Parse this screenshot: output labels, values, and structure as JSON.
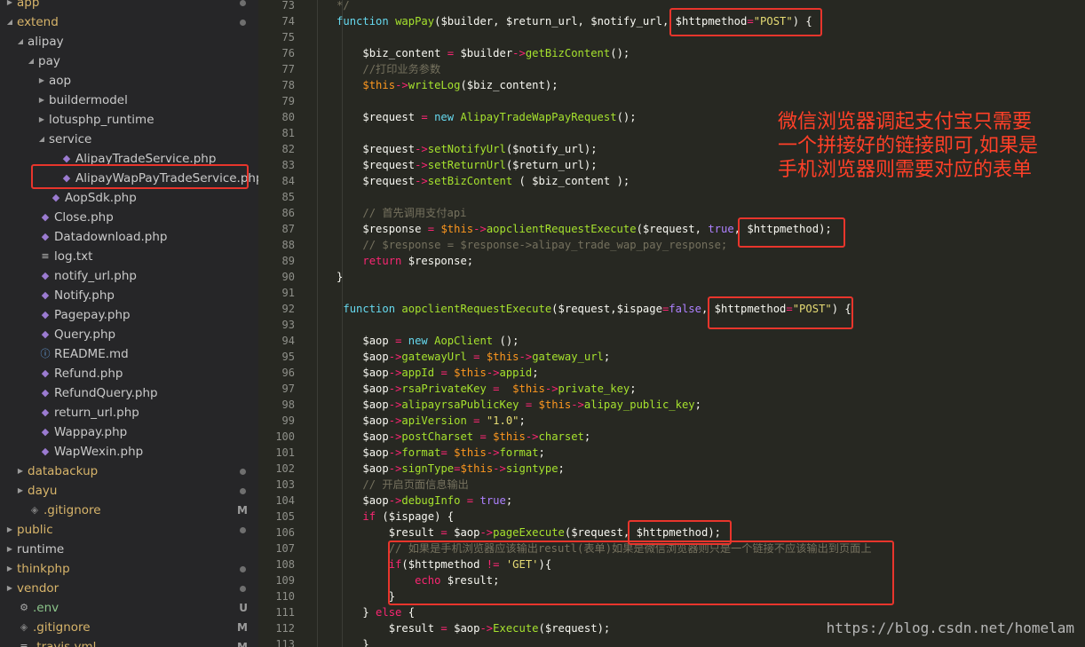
{
  "tree": [
    {
      "label": "app",
      "depth": 0,
      "type": "folder",
      "expanded": false,
      "color": "gold",
      "status": "dot"
    },
    {
      "label": "extend",
      "depth": 0,
      "type": "folder",
      "expanded": true,
      "color": "gold",
      "status": "dot"
    },
    {
      "label": "alipay",
      "depth": 1,
      "type": "folder",
      "expanded": true
    },
    {
      "label": "pay",
      "depth": 2,
      "type": "folder",
      "expanded": true
    },
    {
      "label": "aop",
      "depth": 3,
      "type": "folder",
      "expanded": false
    },
    {
      "label": "buildermodel",
      "depth": 3,
      "type": "folder",
      "expanded": false
    },
    {
      "label": "lotusphp_runtime",
      "depth": 3,
      "type": "folder",
      "expanded": false
    },
    {
      "label": "service",
      "depth": 3,
      "type": "folder",
      "expanded": true
    },
    {
      "label": "AlipayTradeService.php",
      "depth": 4,
      "type": "php"
    },
    {
      "label": "AlipayWapPayTradeService.php",
      "depth": 4,
      "type": "php",
      "highlighted": true
    },
    {
      "label": "AopSdk.php",
      "depth": 3,
      "type": "php"
    },
    {
      "label": "Close.php",
      "depth": 2,
      "type": "php"
    },
    {
      "label": "Datadownload.php",
      "depth": 2,
      "type": "php"
    },
    {
      "label": "log.txt",
      "depth": 2,
      "type": "text"
    },
    {
      "label": "notify_url.php",
      "depth": 2,
      "type": "php"
    },
    {
      "label": "Notify.php",
      "depth": 2,
      "type": "php"
    },
    {
      "label": "Pagepay.php",
      "depth": 2,
      "type": "php"
    },
    {
      "label": "Query.php",
      "depth": 2,
      "type": "php"
    },
    {
      "label": "README.md",
      "depth": 2,
      "type": "info"
    },
    {
      "label": "Refund.php",
      "depth": 2,
      "type": "php"
    },
    {
      "label": "RefundQuery.php",
      "depth": 2,
      "type": "php"
    },
    {
      "label": "return_url.php",
      "depth": 2,
      "type": "php"
    },
    {
      "label": "Wappay.php",
      "depth": 2,
      "type": "php"
    },
    {
      "label": "WapWexin.php",
      "depth": 2,
      "type": "php"
    },
    {
      "label": "databackup",
      "depth": 1,
      "type": "folder",
      "expanded": false,
      "color": "gold",
      "status": "dot"
    },
    {
      "label": "dayu",
      "depth": 1,
      "type": "folder",
      "expanded": false,
      "color": "gold",
      "status": "dot"
    },
    {
      "label": ".gitignore",
      "depth": 1,
      "type": "git",
      "color": "gold",
      "status": "M"
    },
    {
      "label": "public",
      "depth": 0,
      "type": "folder",
      "expanded": false,
      "color": "gold",
      "status": "dot"
    },
    {
      "label": "runtime",
      "depth": 0,
      "type": "folder",
      "expanded": false
    },
    {
      "label": "thinkphp",
      "depth": 0,
      "type": "folder",
      "expanded": false,
      "color": "gold",
      "status": "dot"
    },
    {
      "label": "vendor",
      "depth": 0,
      "type": "folder",
      "expanded": false,
      "color": "gold",
      "status": "dot"
    },
    {
      "label": ".env",
      "depth": 0,
      "type": "gear",
      "color": "green",
      "status": "U"
    },
    {
      "label": ".gitignore",
      "depth": 0,
      "type": "git",
      "color": "gold",
      "status": "M"
    },
    {
      "label": ".travis.yml",
      "depth": 0,
      "type": "text",
      "color": "gold",
      "status": "M"
    }
  ],
  "code_lines": [
    {
      "n": "73",
      "segs": [
        [
          "c",
          "   */"
        ]
      ]
    },
    {
      "n": "74",
      "segs": [
        [
          "p",
          "   "
        ],
        [
          "k",
          "function "
        ],
        [
          "f",
          "wapPay"
        ],
        [
          "p",
          "("
        ],
        [
          "v",
          "$builder"
        ],
        [
          "p",
          ", "
        ],
        [
          "v",
          "$return_url"
        ],
        [
          "p",
          ", "
        ],
        [
          "v",
          "$notify_url"
        ],
        [
          "p",
          ", "
        ],
        [
          "v",
          "$httpmethod"
        ],
        [
          "o",
          "="
        ],
        [
          "s",
          "\"POST\""
        ],
        [
          "p",
          ") {"
        ]
      ]
    },
    {
      "n": "75",
      "segs": []
    },
    {
      "n": "76",
      "segs": [
        [
          "p",
          "       "
        ],
        [
          "v",
          "$biz_content"
        ],
        [
          "o",
          " = "
        ],
        [
          "v",
          "$builder"
        ],
        [
          "o",
          "->"
        ],
        [
          "f",
          "getBizContent"
        ],
        [
          "p",
          "();"
        ]
      ]
    },
    {
      "n": "77",
      "segs": [
        [
          "c",
          "       //打印业务参数"
        ]
      ]
    },
    {
      "n": "78",
      "segs": [
        [
          "p",
          "       "
        ],
        [
          "vk",
          "$this"
        ],
        [
          "o",
          "->"
        ],
        [
          "f",
          "writeLog"
        ],
        [
          "p",
          "("
        ],
        [
          "v",
          "$biz_content"
        ],
        [
          "p",
          ");"
        ]
      ]
    },
    {
      "n": "79",
      "segs": []
    },
    {
      "n": "80",
      "segs": [
        [
          "p",
          "       "
        ],
        [
          "v",
          "$request"
        ],
        [
          "o",
          " = "
        ],
        [
          "k",
          "new "
        ],
        [
          "f",
          "AlipayTradeWapPayRequest"
        ],
        [
          "p",
          "();"
        ]
      ]
    },
    {
      "n": "81",
      "segs": []
    },
    {
      "n": "82",
      "segs": [
        [
          "p",
          "       "
        ],
        [
          "v",
          "$request"
        ],
        [
          "o",
          "->"
        ],
        [
          "f",
          "setNotifyUrl"
        ],
        [
          "p",
          "("
        ],
        [
          "v",
          "$notify_url"
        ],
        [
          "p",
          ");"
        ]
      ]
    },
    {
      "n": "83",
      "segs": [
        [
          "p",
          "       "
        ],
        [
          "v",
          "$request"
        ],
        [
          "o",
          "->"
        ],
        [
          "f",
          "setReturnUrl"
        ],
        [
          "p",
          "("
        ],
        [
          "v",
          "$return_url"
        ],
        [
          "p",
          ");"
        ]
      ]
    },
    {
      "n": "84",
      "segs": [
        [
          "p",
          "       "
        ],
        [
          "v",
          "$request"
        ],
        [
          "o",
          "->"
        ],
        [
          "f",
          "setBizContent"
        ],
        [
          "p",
          " ( "
        ],
        [
          "v",
          "$biz_content"
        ],
        [
          "p",
          " );"
        ]
      ]
    },
    {
      "n": "85",
      "segs": []
    },
    {
      "n": "86",
      "segs": [
        [
          "c",
          "       // 首先调用支付api"
        ]
      ]
    },
    {
      "n": "87",
      "segs": [
        [
          "p",
          "       "
        ],
        [
          "v",
          "$response"
        ],
        [
          "o",
          " = "
        ],
        [
          "vk",
          "$this"
        ],
        [
          "o",
          "->"
        ],
        [
          "f",
          "aopclientRequestExecute"
        ],
        [
          "p",
          "("
        ],
        [
          "v",
          "$request"
        ],
        [
          "p",
          ", "
        ],
        [
          "t",
          "true"
        ],
        [
          "p",
          ", "
        ],
        [
          "v",
          "$httpmethod"
        ],
        [
          "p",
          ");"
        ]
      ]
    },
    {
      "n": "88",
      "segs": [
        [
          "c",
          "       // $response = $response->alipay_trade_wap_pay_response;"
        ]
      ]
    },
    {
      "n": "89",
      "segs": [
        [
          "p",
          "       "
        ],
        [
          "kw",
          "return "
        ],
        [
          "v",
          "$response"
        ],
        [
          "p",
          ";"
        ]
      ]
    },
    {
      "n": "90",
      "segs": [
        [
          "p",
          "   }"
        ]
      ]
    },
    {
      "n": "91",
      "segs": []
    },
    {
      "n": "92",
      "segs": [
        [
          "p",
          "    "
        ],
        [
          "k",
          "function "
        ],
        [
          "f",
          "aopclientRequestExecute"
        ],
        [
          "p",
          "("
        ],
        [
          "v",
          "$request"
        ],
        [
          "p",
          ","
        ],
        [
          "v",
          "$ispage"
        ],
        [
          "o",
          "="
        ],
        [
          "t",
          "false"
        ],
        [
          "p",
          ", "
        ],
        [
          "v",
          "$httpmethod"
        ],
        [
          "o",
          "="
        ],
        [
          "s",
          "\"POST\""
        ],
        [
          "p",
          ") {"
        ]
      ]
    },
    {
      "n": "93",
      "segs": []
    },
    {
      "n": "94",
      "segs": [
        [
          "p",
          "       "
        ],
        [
          "v",
          "$aop"
        ],
        [
          "o",
          " = "
        ],
        [
          "k",
          "new "
        ],
        [
          "f",
          "AopClient"
        ],
        [
          "p",
          " ();"
        ]
      ]
    },
    {
      "n": "95",
      "segs": [
        [
          "p",
          "       "
        ],
        [
          "v",
          "$aop"
        ],
        [
          "o",
          "->"
        ],
        [
          "f",
          "gatewayUrl"
        ],
        [
          "o",
          " = "
        ],
        [
          "vk",
          "$this"
        ],
        [
          "o",
          "->"
        ],
        [
          "f",
          "gateway_url"
        ],
        [
          "p",
          ";"
        ]
      ]
    },
    {
      "n": "96",
      "segs": [
        [
          "p",
          "       "
        ],
        [
          "v",
          "$aop"
        ],
        [
          "o",
          "->"
        ],
        [
          "f",
          "appId"
        ],
        [
          "o",
          " = "
        ],
        [
          "vk",
          "$this"
        ],
        [
          "o",
          "->"
        ],
        [
          "f",
          "appid"
        ],
        [
          "p",
          ";"
        ]
      ]
    },
    {
      "n": "97",
      "segs": [
        [
          "p",
          "       "
        ],
        [
          "v",
          "$aop"
        ],
        [
          "o",
          "->"
        ],
        [
          "f",
          "rsaPrivateKey"
        ],
        [
          "o",
          " =  "
        ],
        [
          "vk",
          "$this"
        ],
        [
          "o",
          "->"
        ],
        [
          "f",
          "private_key"
        ],
        [
          "p",
          ";"
        ]
      ]
    },
    {
      "n": "98",
      "segs": [
        [
          "p",
          "       "
        ],
        [
          "v",
          "$aop"
        ],
        [
          "o",
          "->"
        ],
        [
          "f",
          "alipayrsaPublicKey"
        ],
        [
          "o",
          " = "
        ],
        [
          "vk",
          "$this"
        ],
        [
          "o",
          "->"
        ],
        [
          "f",
          "alipay_public_key"
        ],
        [
          "p",
          ";"
        ]
      ]
    },
    {
      "n": "99",
      "segs": [
        [
          "p",
          "       "
        ],
        [
          "v",
          "$aop"
        ],
        [
          "o",
          "->"
        ],
        [
          "f",
          "apiVersion"
        ],
        [
          "o",
          " = "
        ],
        [
          "s",
          "\"1.0\""
        ],
        [
          "p",
          ";"
        ]
      ]
    },
    {
      "n": "100",
      "segs": [
        [
          "p",
          "       "
        ],
        [
          "v",
          "$aop"
        ],
        [
          "o",
          "->"
        ],
        [
          "f",
          "postCharset"
        ],
        [
          "o",
          " = "
        ],
        [
          "vk",
          "$this"
        ],
        [
          "o",
          "->"
        ],
        [
          "f",
          "charset"
        ],
        [
          "p",
          ";"
        ]
      ]
    },
    {
      "n": "101",
      "segs": [
        [
          "p",
          "       "
        ],
        [
          "v",
          "$aop"
        ],
        [
          "o",
          "->"
        ],
        [
          "f",
          "format"
        ],
        [
          "o",
          "= "
        ],
        [
          "vk",
          "$this"
        ],
        [
          "o",
          "->"
        ],
        [
          "f",
          "format"
        ],
        [
          "p",
          ";"
        ]
      ]
    },
    {
      "n": "102",
      "segs": [
        [
          "p",
          "       "
        ],
        [
          "v",
          "$aop"
        ],
        [
          "o",
          "->"
        ],
        [
          "f",
          "signType"
        ],
        [
          "o",
          "="
        ],
        [
          "vk",
          "$this"
        ],
        [
          "o",
          "->"
        ],
        [
          "f",
          "signtype"
        ],
        [
          "p",
          ";"
        ]
      ]
    },
    {
      "n": "103",
      "segs": [
        [
          "c",
          "       // 开启页面信息输出"
        ]
      ]
    },
    {
      "n": "104",
      "segs": [
        [
          "p",
          "       "
        ],
        [
          "v",
          "$aop"
        ],
        [
          "o",
          "->"
        ],
        [
          "f",
          "debugInfo"
        ],
        [
          "o",
          " = "
        ],
        [
          "t",
          "true"
        ],
        [
          "p",
          ";"
        ]
      ]
    },
    {
      "n": "105",
      "segs": [
        [
          "p",
          "       "
        ],
        [
          "kw",
          "if "
        ],
        [
          "p",
          "("
        ],
        [
          "v",
          "$ispage"
        ],
        [
          "p",
          ") {"
        ]
      ]
    },
    {
      "n": "106",
      "segs": [
        [
          "p",
          "           "
        ],
        [
          "v",
          "$result"
        ],
        [
          "o",
          " = "
        ],
        [
          "v",
          "$aop"
        ],
        [
          "o",
          "->"
        ],
        [
          "f",
          "pageExecute"
        ],
        [
          "p",
          "("
        ],
        [
          "v",
          "$request"
        ],
        [
          "p",
          ", "
        ],
        [
          "v",
          "$httpmethod"
        ],
        [
          "p",
          ");"
        ]
      ]
    },
    {
      "n": "107",
      "segs": [
        [
          "c",
          "           // 如果是手机浏览器应该输出resutl(表单)如果是微信浏览器则只是一个链接不应该输出到页面上"
        ]
      ]
    },
    {
      "n": "108",
      "segs": [
        [
          "p",
          "           "
        ],
        [
          "kw",
          "if"
        ],
        [
          "p",
          "("
        ],
        [
          "v",
          "$httpmethod"
        ],
        [
          "o",
          " != "
        ],
        [
          "s",
          "'GET'"
        ],
        [
          "p",
          "){"
        ]
      ]
    },
    {
      "n": "109",
      "segs": [
        [
          "p",
          "               "
        ],
        [
          "kw",
          "echo "
        ],
        [
          "v",
          "$result"
        ],
        [
          "p",
          ";"
        ]
      ]
    },
    {
      "n": "110",
      "segs": [
        [
          "p",
          "           }"
        ]
      ]
    },
    {
      "n": "111",
      "segs": [
        [
          "p",
          "       } "
        ],
        [
          "kw",
          "else "
        ],
        [
          "p",
          "{"
        ]
      ]
    },
    {
      "n": "112",
      "segs": [
        [
          "p",
          "           "
        ],
        [
          "v",
          "$result"
        ],
        [
          "o",
          " = "
        ],
        [
          "v",
          "$aop"
        ],
        [
          "o",
          "->"
        ],
        [
          "f",
          "Execute"
        ],
        [
          "p",
          "("
        ],
        [
          "v",
          "$request"
        ],
        [
          "p",
          ");"
        ]
      ]
    },
    {
      "n": "113",
      "segs": [
        [
          "p",
          "       }"
        ]
      ]
    }
  ],
  "annotation": {
    "line1": "微信浏览器调起支付宝只需要",
    "line2": "一个拼接好的链接即可,如果是",
    "line3": "手机浏览器则需要对应的表单"
  },
  "watermark": "https://blog.csdn.net/homelam",
  "colors": {
    "highlight_box": "#e8352c",
    "annotation_text": "#ff4028"
  }
}
